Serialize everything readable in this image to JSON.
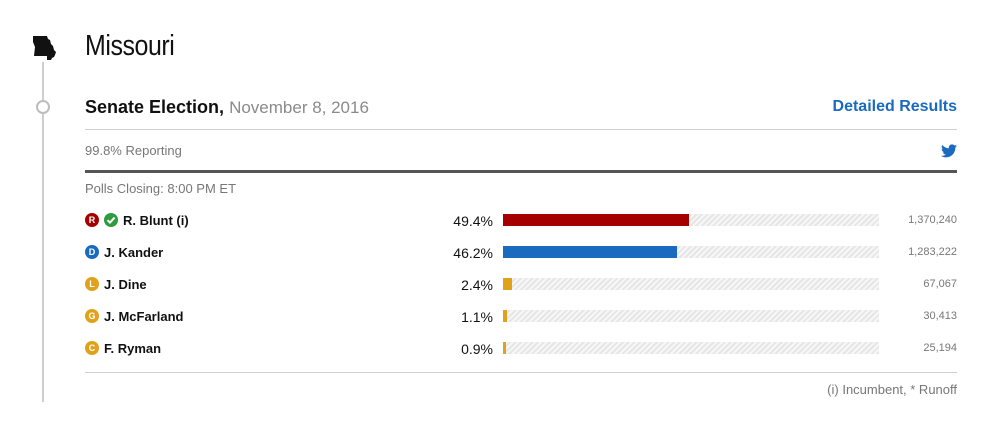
{
  "state": {
    "name": "Missouri",
    "icon": "missouri-state-icon"
  },
  "race": {
    "name": "Senate Election,",
    "date": "November 8, 2016",
    "detailed_link": "Detailed Results"
  },
  "reporting": {
    "text": "99.8% Reporting",
    "share_icon": "twitter-icon"
  },
  "polls_closing": "Polls Closing: 8:00 PM ET",
  "candidates": [
    {
      "party": "R",
      "name": "R. Blunt (i)",
      "winner": true,
      "pct_label": "49.4%",
      "pct": 49.4,
      "votes": "1,370,240",
      "color": "#a50000"
    },
    {
      "party": "D",
      "name": "J. Kander",
      "winner": false,
      "pct_label": "46.2%",
      "pct": 46.2,
      "votes": "1,283,222",
      "color": "#1a6bbf"
    },
    {
      "party": "L",
      "name": "J. Dine",
      "winner": false,
      "pct_label": "2.4%",
      "pct": 2.4,
      "votes": "67,067",
      "color": "#e1a21b"
    },
    {
      "party": "G",
      "name": "J. McFarland",
      "winner": false,
      "pct_label": "1.1%",
      "pct": 1.1,
      "votes": "30,413",
      "color": "#e1a21b"
    },
    {
      "party": "C",
      "name": "F. Ryman",
      "winner": false,
      "pct_label": "0.9%",
      "pct": 0.9,
      "votes": "25,194",
      "color": "#e1a21b"
    }
  ],
  "footnote": "(i) Incumbent, * Runoff"
}
